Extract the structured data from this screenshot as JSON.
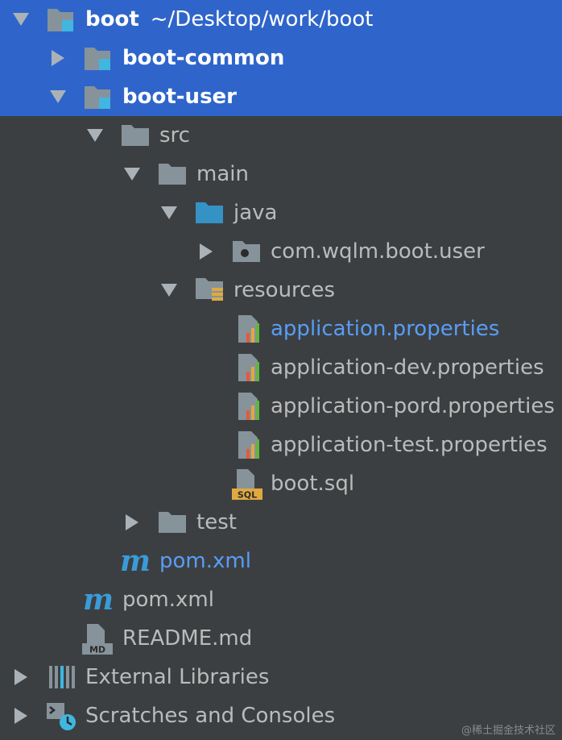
{
  "project": {
    "root": {
      "name": "boot",
      "path": "~/Desktop/work/boot"
    },
    "boot_common": "boot-common",
    "boot_user": "boot-user",
    "src": "src",
    "main": "main",
    "java": "java",
    "package": "com.wqlm.boot.user",
    "resources": "resources",
    "files": [
      "application.properties",
      "application-dev.properties",
      "application-pord.properties",
      "application-test.properties"
    ],
    "sql_file": "boot.sql",
    "sql_badge": "SQL",
    "test": "test",
    "module_pom": "pom.xml",
    "root_pom": "pom.xml",
    "readme": "README.md",
    "md_badge": "MD",
    "maven_glyph": "m"
  },
  "external_libraries": "External Libraries",
  "scratches": "Scratches and Consoles",
  "watermark": "@稀土掘金技术社区",
  "colors": {
    "selection": "#2f65ca",
    "background": "#3c3f41",
    "folder": "#87939a",
    "module_badge": "#40b6e0",
    "source_folder": "#3592c4",
    "link_text": "#589df6"
  },
  "icons": {
    "folder": "folder-icon",
    "module": "module-icon",
    "package": "package-icon",
    "resources": "resources-folder-icon",
    "properties": "properties-file-icon",
    "sql": "sql-file-icon",
    "maven": "maven-icon",
    "markdown": "markdown-file-icon",
    "libraries": "libraries-icon",
    "scratches": "scratches-icon"
  }
}
